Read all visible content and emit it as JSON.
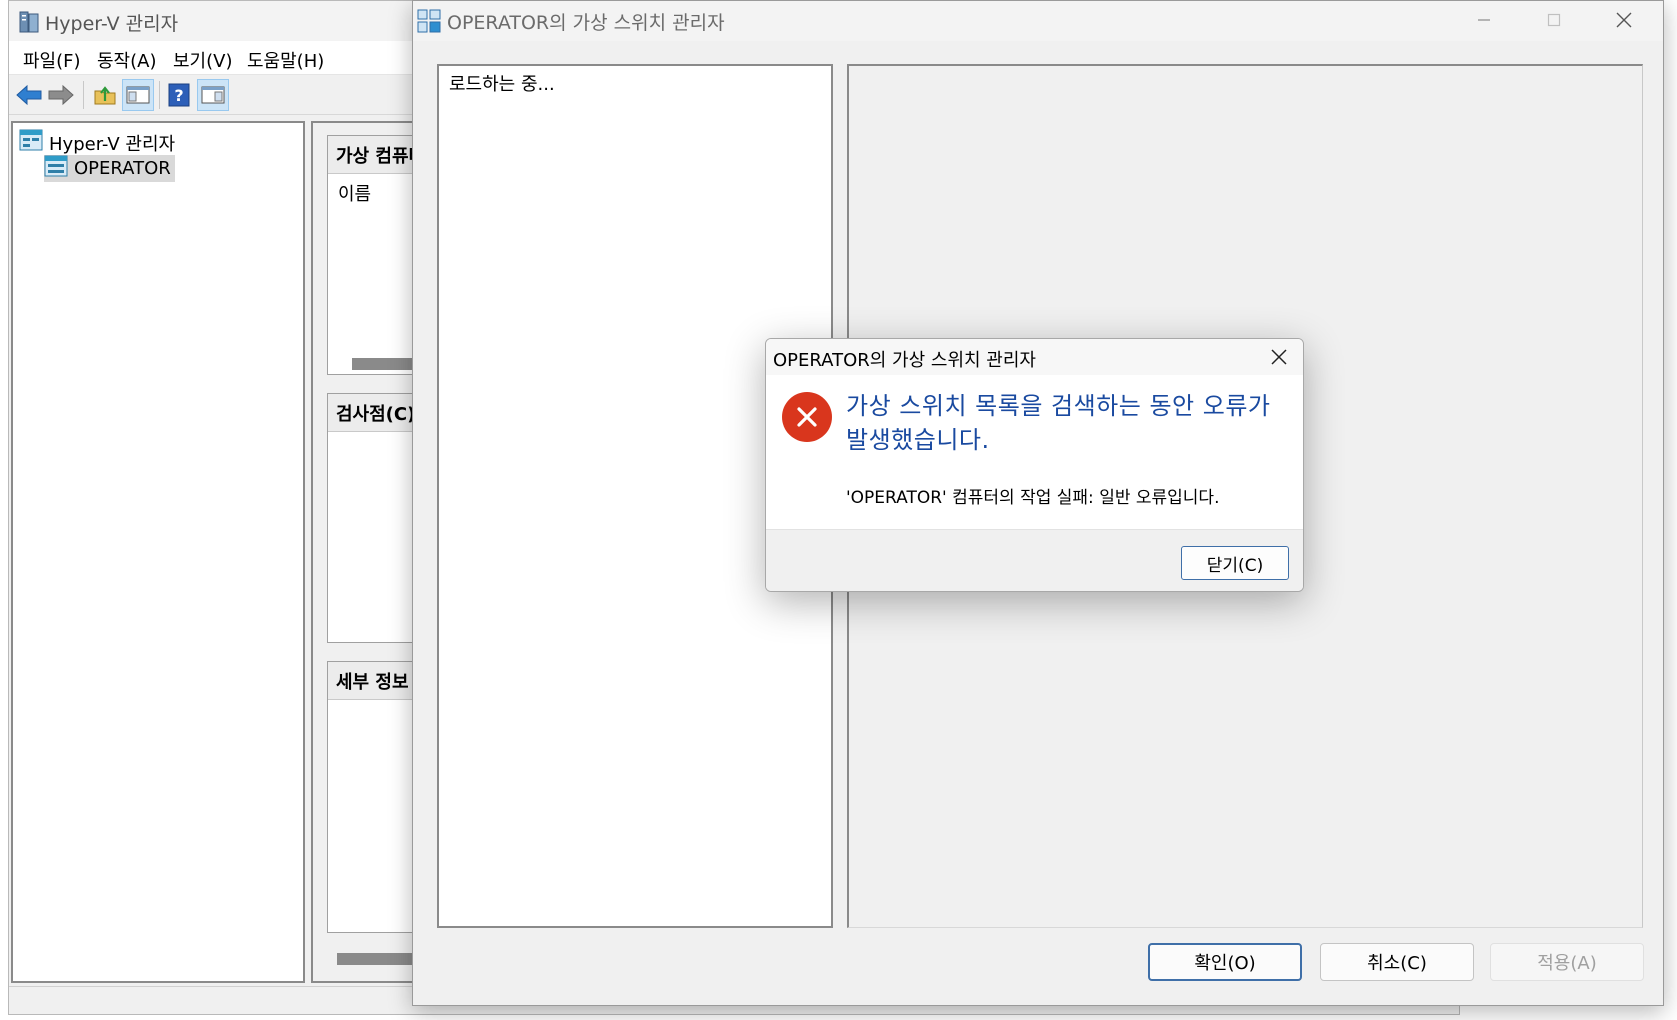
{
  "hyperv": {
    "title": "Hyper-V 관리자",
    "menu": [
      "파일(F)",
      "동작(A)",
      "보기(V)",
      "도움말(H)"
    ],
    "toolbar_icons": [
      "back-arrow-icon",
      "forward-arrow-icon",
      "folder-up-icon",
      "show-hide-console-tree-icon",
      "help-icon",
      "show-hide-action-pane-icon"
    ],
    "tree": {
      "root": "Hyper-V 관리자",
      "server": "OPERATOR"
    },
    "panes": {
      "vm_header": "가상 컴퓨터(I)",
      "vm_column_name": "이름",
      "checkpoint_header": "검사점(C)",
      "details_header": "세부 정보"
    }
  },
  "switch_manager": {
    "title": "OPERATOR의 가상 스위치 관리자",
    "loading_text": "로드하는 중...",
    "buttons": {
      "ok": "확인(O)",
      "cancel": "취소(C)",
      "apply": "적용(A)"
    }
  },
  "error_dialog": {
    "title": "OPERATOR의 가상 스위치 관리자",
    "main_message": "가상 스위치 목록을 검색하는 동안 오류가 발생했습니다.",
    "detail_message": "'OPERATOR' 컴퓨터의 작업 실패: 일반 오류입니다.",
    "close_button": "닫기(C)",
    "icon": "error-icon",
    "icon_color": "#d9361d",
    "message_color": "#1a4aa0"
  }
}
